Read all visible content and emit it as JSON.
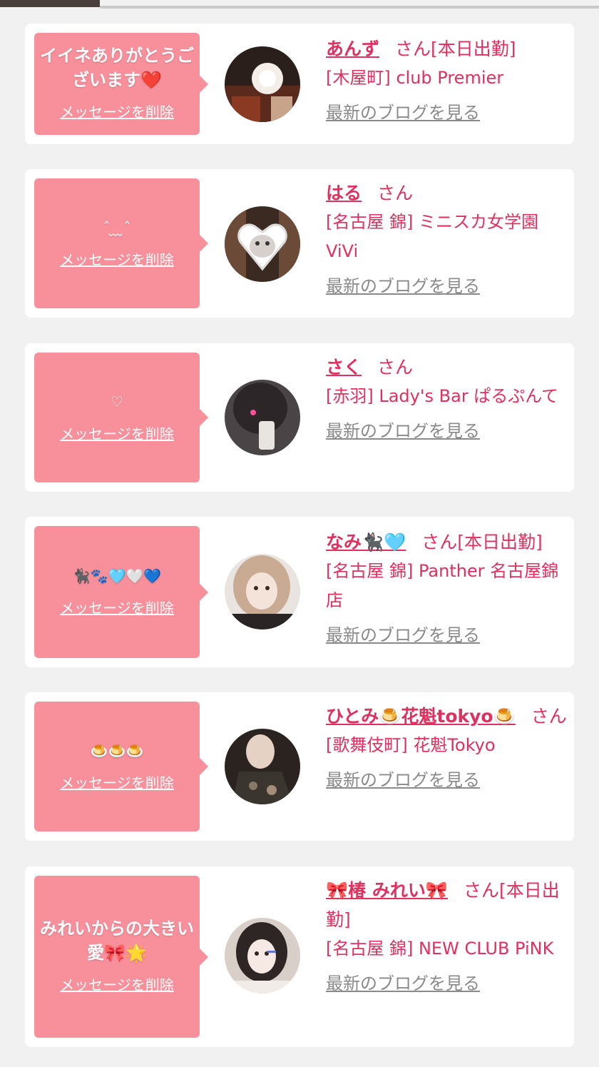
{
  "cards": [
    {
      "message": "イイネありがとうございます❤️",
      "delete_label": "メッセージを削除",
      "name": "あんず",
      "san": "さん[本日出勤]",
      "shop": "[木屋町] club Premier",
      "blog_label": "最新のブログを見る"
    },
    {
      "message": "ˆ ̮ ̮ ̮ˆ",
      "delete_label": "メッセージを削除",
      "name": "はる",
      "san": "さん",
      "shop": "[名古屋 錦] ミニスカ女学園ViVi",
      "blog_label": "最新のブログを見る"
    },
    {
      "message": "♡",
      "delete_label": "メッセージを削除",
      "name": "さく",
      "san": "さん",
      "shop": "[赤羽] Lady's Bar ぱるぷんて",
      "blog_label": "最新のブログを見る"
    },
    {
      "message": "🐈‍⬛🐾🩵🤍💙",
      "delete_label": "メッセージを削除",
      "name": "なみ🐈‍⬛🩵",
      "san": "さん[本日出勤]",
      "shop": "[名古屋 錦] Panther 名古屋錦店",
      "blog_label": "最新のブログを見る"
    },
    {
      "message": "🍮🍮🍮",
      "delete_label": "メッセージを削除",
      "name": "ひとみ🍮花魁tokyo🍮",
      "san": "さん",
      "shop": "[歌舞伎町] 花魁Tokyo",
      "blog_label": "最新のブログを見る"
    },
    {
      "message": "みれいからの大きい愛🎀🌟",
      "delete_label": "メッセージを削除",
      "name": "🎀椿 みれい🎀",
      "san": "さん[本日出勤]",
      "shop": "[名古屋 錦] NEW CLUB PiNK",
      "blog_label": "最新のブログを見る"
    }
  ],
  "colors": {
    "bubble": "#f8909c",
    "accent": "#e0305f",
    "muted": "#8a8a8a",
    "background": "#f1f1f1"
  }
}
